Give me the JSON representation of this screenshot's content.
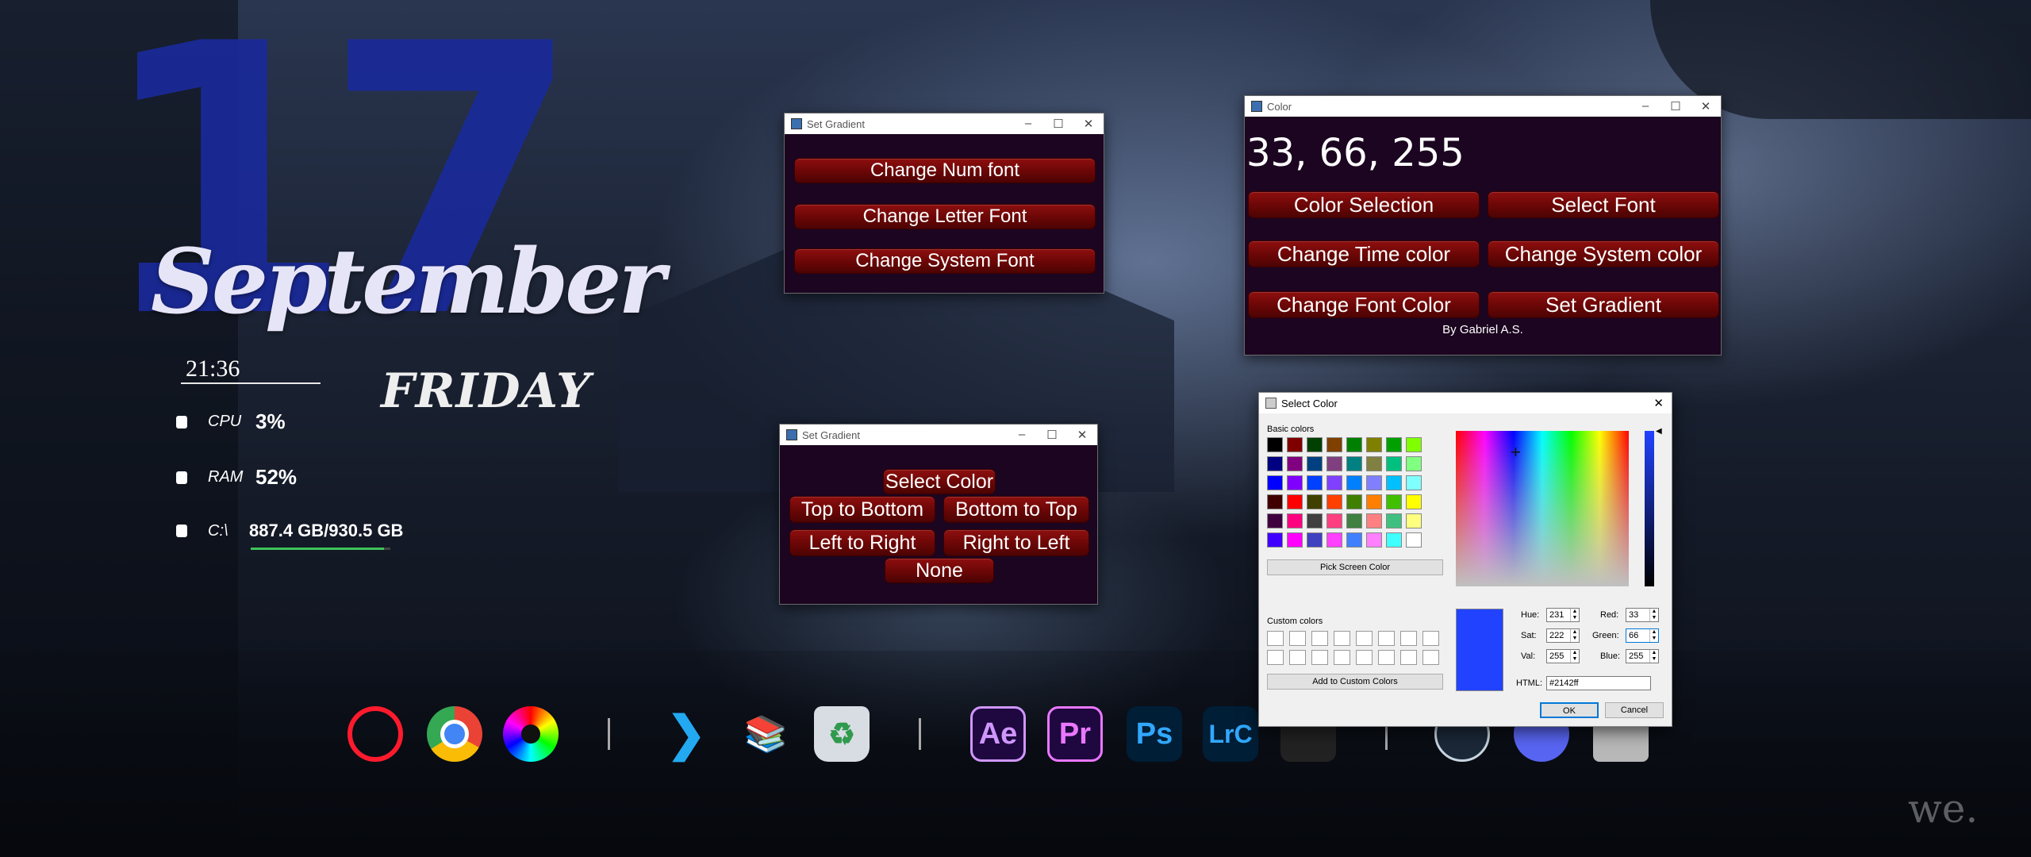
{
  "desktop": {
    "day_number": "17",
    "month": "September",
    "time": "21:36",
    "weekday": "FRIDAY",
    "stats": [
      {
        "label": "CPU",
        "value": "3%",
        "icon": "cpu-icon"
      },
      {
        "label": "RAM",
        "value": "52%",
        "icon": "ram-icon"
      },
      {
        "label": "C:\\",
        "value": "887.4 GB/930.5 GB",
        "icon": "disk-icon"
      }
    ],
    "disk_usage_fraction": 0.954,
    "watermark": "we."
  },
  "dock": {
    "icons": [
      {
        "name": "opera-icon",
        "glyph": "O"
      },
      {
        "name": "chrome-icon",
        "glyph": ""
      },
      {
        "name": "color-wheel-icon",
        "glyph": ""
      },
      {
        "name": "vscode-icon",
        "glyph": "❯"
      },
      {
        "name": "library-icon",
        "glyph": "📚"
      },
      {
        "name": "recycle-bin-icon",
        "glyph": "♻"
      },
      {
        "name": "after-effects-icon",
        "glyph": "Ae"
      },
      {
        "name": "premiere-icon",
        "glyph": "Pr"
      },
      {
        "name": "photoshop-icon",
        "glyph": "Ps"
      },
      {
        "name": "lightroom-icon",
        "glyph": "LrC"
      },
      {
        "name": "davinci-icon",
        "glyph": ""
      },
      {
        "name": "steam-icon",
        "glyph": ""
      },
      {
        "name": "discord-icon",
        "glyph": ""
      },
      {
        "name": "gameboy-icon",
        "glyph": ""
      }
    ]
  },
  "font_window": {
    "title": "Set Gradient",
    "buttons": [
      "Change Num font",
      "Change Letter Font",
      "Change System Font"
    ]
  },
  "gradient_window": {
    "title": "Set Gradient",
    "select_color": "Select Color",
    "top_to_bottom": "Top to Bottom",
    "bottom_to_top": "Bottom to Top",
    "left_to_right": "Left to Right",
    "right_to_left": "Right to Left",
    "none": "None"
  },
  "color_window": {
    "title": "Color",
    "rgb_readout": "33, 66, 255",
    "color_selection": "Color Selection",
    "select_font": "Select Font",
    "change_time_color": "Change Time color",
    "change_system_color": "Change System color",
    "change_font_color": "Change Font Color",
    "set_gradient": "Set Gradient",
    "credit": "By Gabriel A.S."
  },
  "select_color_dialog": {
    "title": "Select Color",
    "basic_colors_label": "Basic colors",
    "basic_colors": [
      "#000000",
      "#800000",
      "#004000",
      "#804000",
      "#008000",
      "#808000",
      "#00a000",
      "#80ff00",
      "#000080",
      "#800080",
      "#004080",
      "#804080",
      "#008080",
      "#808040",
      "#00c080",
      "#80ff80",
      "#0000ff",
      "#8000ff",
      "#0040ff",
      "#8040ff",
      "#0080ff",
      "#8080ff",
      "#00c0ff",
      "#80ffff",
      "#400000",
      "#ff0000",
      "#404000",
      "#ff4000",
      "#408000",
      "#ff8000",
      "#40c000",
      "#ffff00",
      "#400040",
      "#ff0080",
      "#404040",
      "#ff4080",
      "#408040",
      "#ff8080",
      "#40c080",
      "#ffff80",
      "#4000ff",
      "#ff00ff",
      "#4040c0",
      "#ff40ff",
      "#4080ff",
      "#ff80ff",
      "#40ffff",
      "#ffffff"
    ],
    "pick_screen_color": "Pick Screen Color",
    "custom_colors_label": "Custom colors",
    "add_to_custom": "Add to Custom Colors",
    "hue_label": "Hue:",
    "hue": "231",
    "sat_label": "Sat:",
    "sat": "222",
    "val_label": "Val:",
    "val": "255",
    "red_label": "Red:",
    "red": "33",
    "green_label": "Green:",
    "green": "66",
    "blue_label": "Blue:",
    "blue": "255",
    "html_label": "HTML:",
    "html": "#2142ff",
    "ok": "OK",
    "cancel": "Cancel",
    "current_color": "#2142ff"
  }
}
